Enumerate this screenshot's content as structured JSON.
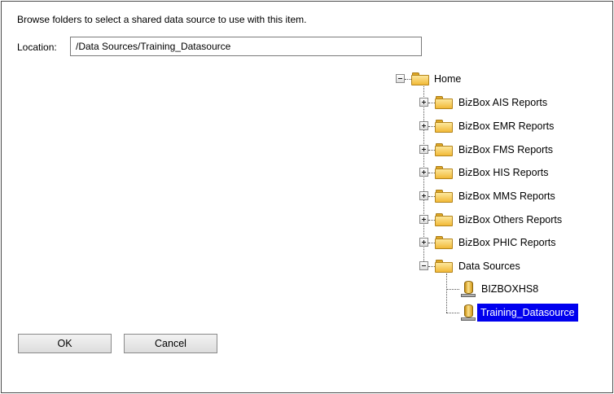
{
  "dialog": {
    "instruction": "Browse folders to select a shared data source to use with this item.",
    "location_label": "Location:",
    "location_value": "/Data Sources/Training_Datasource"
  },
  "tree": {
    "root": {
      "label": "Home",
      "expanded": true
    },
    "folders": [
      {
        "label": "BizBox AIS Reports",
        "expanded": false
      },
      {
        "label": "BizBox EMR Reports",
        "expanded": false
      },
      {
        "label": "BizBox FMS Reports",
        "expanded": false
      },
      {
        "label": "BizBox HIS Reports",
        "expanded": false
      },
      {
        "label": "BizBox MMS Reports",
        "expanded": false
      },
      {
        "label": "BizBox Others Reports",
        "expanded": false
      },
      {
        "label": "BizBox PHIC Reports",
        "expanded": false
      },
      {
        "label": "Data Sources",
        "expanded": true
      }
    ],
    "datasources": [
      {
        "label": "BIZBOXHS8",
        "selected": false
      },
      {
        "label": "Training_Datasource",
        "selected": true
      }
    ]
  },
  "buttons": {
    "ok": "OK",
    "cancel": "Cancel"
  },
  "colors": {
    "selection": "#0000ee",
    "folder": "#f2b937"
  }
}
